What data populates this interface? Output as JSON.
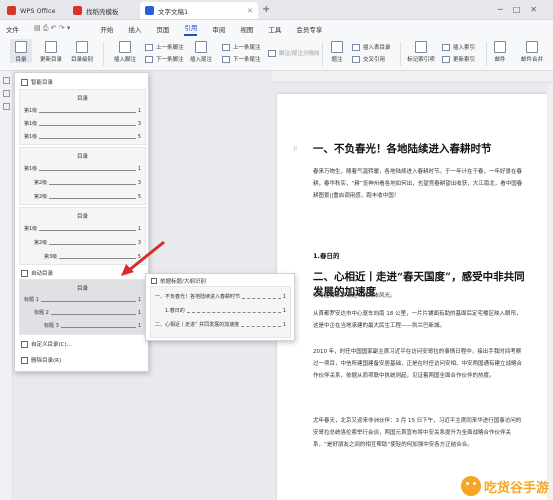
{
  "tabs": [
    {
      "label": "WPS Office",
      "color": "#d9342b"
    },
    {
      "label": "找稻壳模板",
      "color": "#d9342b"
    },
    {
      "label": "文字文稿1",
      "color": "#2b5fd9"
    }
  ],
  "menu": [
    "文件",
    "开始",
    "插入",
    "页面",
    "引用",
    "审阅",
    "视图",
    "工具",
    "会员专享"
  ],
  "menu_active": "引用",
  "ribbon": {
    "toc": "目录",
    "update_toc": "更新目录",
    "toc_level": "目录级别",
    "insert_footnote": "插入脚注",
    "prev_footnote": "上一条脚注",
    "next_footnote": "下一条脚注",
    "insert_endnote": "插入尾注",
    "prev_endnote": "上一条尾注",
    "next_endnote": "下一条尾注",
    "note_options": "脚注/尾注分隔线",
    "caption": "题注",
    "insert_toc_figures": "插入表目录",
    "cross_ref": "交叉引用",
    "mark_index": "标记索引项",
    "insert_index": "插入索引",
    "update_index": "更新索引",
    "mail": "邮件",
    "mail_merge": "邮件合并"
  },
  "dropdown": {
    "smart_toc": "智能目录",
    "preview_title": "目录",
    "previews": [
      {
        "rows": [
          {
            "label": "第1级",
            "page": "1"
          },
          {
            "label": "第1级",
            "page": "3"
          },
          {
            "label": "第1级",
            "page": "5"
          }
        ]
      },
      {
        "rows": [
          {
            "label": "第1级",
            "page": "1"
          },
          {
            "label": "第2级",
            "page": "3"
          },
          {
            "label": "第2级",
            "page": "5"
          }
        ]
      },
      {
        "rows": [
          {
            "label": "第1级",
            "page": "1"
          },
          {
            "label": "第2级",
            "page": "3"
          },
          {
            "label": "第3级",
            "page": "5"
          }
        ]
      }
    ],
    "auto_toc": "自动目录",
    "auto_preview": {
      "title": "目录",
      "rows": [
        {
          "label": "标题 1",
          "page": "1"
        },
        {
          "label": "标题 2",
          "page": "1"
        },
        {
          "label": "标题 3",
          "page": "1"
        }
      ]
    },
    "custom_toc": "自定义目录(C)...",
    "delete_toc": "删除目录(R)"
  },
  "submenu": {
    "title": "依据标题/大纲识别",
    "rows": [
      {
        "label": "一、不负春光！各地陆续进入春耕时节",
        "page": "1"
      },
      {
        "label": "1.春日的",
        "page": "1"
      },
      {
        "label": "二、心相近丨走进“  并同发展的加速度",
        "page": "1"
      }
    ]
  },
  "document": {
    "h1a": "一、不负春光！各地陆续进入春耕时节",
    "p1": "春来万物生，随着气温转暖，各地陆续进入春耕时节。于一年计在于春，一年好景在春耕，春华秋实，“耕”览神州看各地如何出，也望竞春耕望出收获，大江南北，看中国春耕图景||重启调用感，跑丰收中国！",
    "h3": "1.春日的",
    "h1b": "二、心相近丨走进“春天国度”，感受中非共同发展的加速度",
    "p2": "安哥拉首都罗安达市的城市风光。",
    "p3": "从首都罗安达市中心驱车向南 18 公里，一片片铺面有助的基面后定宅楼区映入眼帘，这是中企在当地承建的最大民生工程——凯兰巴新城。",
    "p4": "2010 年，时任中国国家副主席习近平在访问安哥拉的事情日程中，接出手我时间考察过一项目，中信所建国建备安居基础，正是在时任访问安相、中安两国通有建立战略合作伙伴关系，依据从而项联中执统则起，见证着两国全面合作伙伴的热度。",
    "p5": "尤年春天，北京又迎来非洲伙伴：3 月 15 日下午，习近平主席同来华进行国事访问的安哥拉总统洛伦索举行会谈，两国元首宣布将中安关系提升为全面战略合作伙伴关系，“是好朋友之间的相互帮助”使轻的何加强中安各方正结合合。"
  },
  "watermark": "吃货谷手游"
}
